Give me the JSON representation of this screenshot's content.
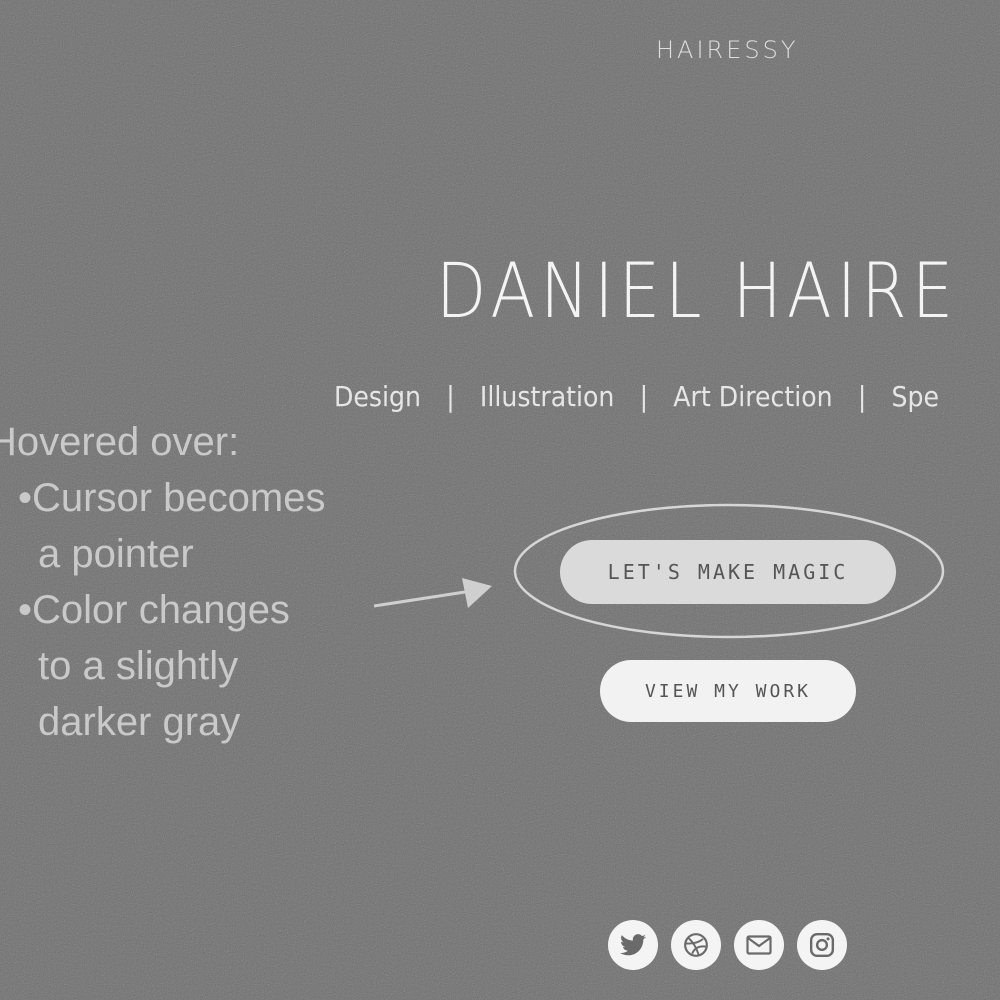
{
  "header": {
    "logo_text": "HAIRESSY"
  },
  "hero": {
    "title": "DANIEL HAIRE",
    "nav": [
      {
        "label": "Design"
      },
      {
        "label": "Illustration"
      },
      {
        "label": "Art Direction"
      },
      {
        "label": "Spe"
      }
    ],
    "separator": "|"
  },
  "annotation": {
    "lines": [
      "Hovered over:",
      "•Cursor becomes",
      "a pointer",
      "•Color changes",
      "to a slightly",
      "darker gray"
    ]
  },
  "buttons": {
    "primary_label": "LET'S MAKE MAGIC",
    "primary_state": "hovered",
    "secondary_label": "VIEW MY WORK"
  },
  "socials": [
    {
      "icon": "twitter-icon"
    },
    {
      "icon": "dribbble-icon"
    },
    {
      "icon": "mail-icon"
    },
    {
      "icon": "instagram-icon"
    }
  ],
  "colors": {
    "background": "#6e6e6e",
    "text_light": "#f4f4f4",
    "primary_button_hover": "#dadada",
    "secondary_button": "#f2f2f2",
    "annotation_text": "#c9c9c9"
  }
}
